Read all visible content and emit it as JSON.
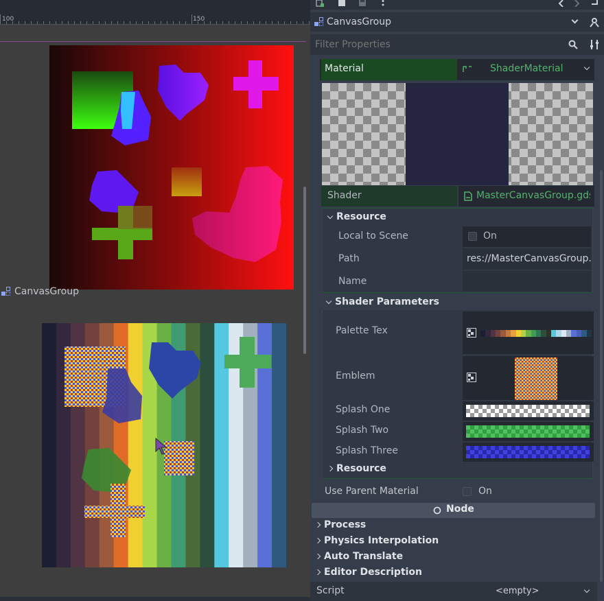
{
  "viewport": {
    "ruler_labels": [
      "100",
      "150"
    ],
    "node_label": "CanvasGroup",
    "top_canvas_shapes": [
      "green-square",
      "cyan-blob",
      "violet-heart",
      "magenta-cross",
      "yellow-square",
      "violet-blob",
      "green-cross",
      "pink-blob"
    ],
    "bottom_canvas_shapes": [
      "checker-square",
      "blue-blob",
      "blue-heart",
      "green-cross",
      "checker-square-small",
      "green-blob",
      "checker-cross"
    ]
  },
  "inspector": {
    "toolbar_icons": [
      "new-resource-icon",
      "load-resource-icon",
      "save-resource-icon",
      "more-icon",
      "back-icon",
      "forward-icon",
      "history-icon"
    ],
    "node_name": "CanvasGroup",
    "filter_placeholder": "Filter Properties",
    "material": {
      "label": "Material",
      "value": "ShaderMaterial",
      "shader_label": "Shader",
      "shader_value": "MasterCanvasGroup.gdshader",
      "resource_title": "Resource",
      "local_to_scene_label": "Local to Scene",
      "local_to_scene_value": "On",
      "path_label": "Path",
      "path_value": "res://MasterCanvasGroup.",
      "name_label": "Name",
      "name_value": ""
    },
    "shader_params": {
      "title": "Shader Parameters",
      "palette_tex_label": "Palette Tex",
      "emblem_label": "Emblem",
      "splash_one_label": "Splash One",
      "splash_two_label": "Splash Two",
      "splash_three_label": "Splash Three",
      "resource_title": "Resource"
    },
    "use_parent_material_label": "Use Parent Material",
    "use_parent_material_value": "On",
    "node_section": "Node",
    "sections": [
      "Process",
      "Physics Interpolation",
      "Auto Translate",
      "Editor Description"
    ],
    "script_label": "Script",
    "script_value": "<empty>"
  },
  "colors": {
    "accent_green": "#1a4a22",
    "resource_text_green": "#55b26d",
    "panel_bg": "#363d4a"
  },
  "palette": [
    "#1c1f33",
    "#33283d",
    "#503444",
    "#73423f",
    "#9c5a3c",
    "#c47a3d",
    "#e6a040",
    "#f0d030",
    "#b4d04a",
    "#6ab044",
    "#3f9c52",
    "#2f7855",
    "#2c4e3d",
    "#2a3328",
    "#55c8e0",
    "#a8d8ea",
    "#dce8f0",
    "#a2b0c0",
    "#5870d8",
    "#4a60b8",
    "#2f5a80",
    "#203648"
  ]
}
